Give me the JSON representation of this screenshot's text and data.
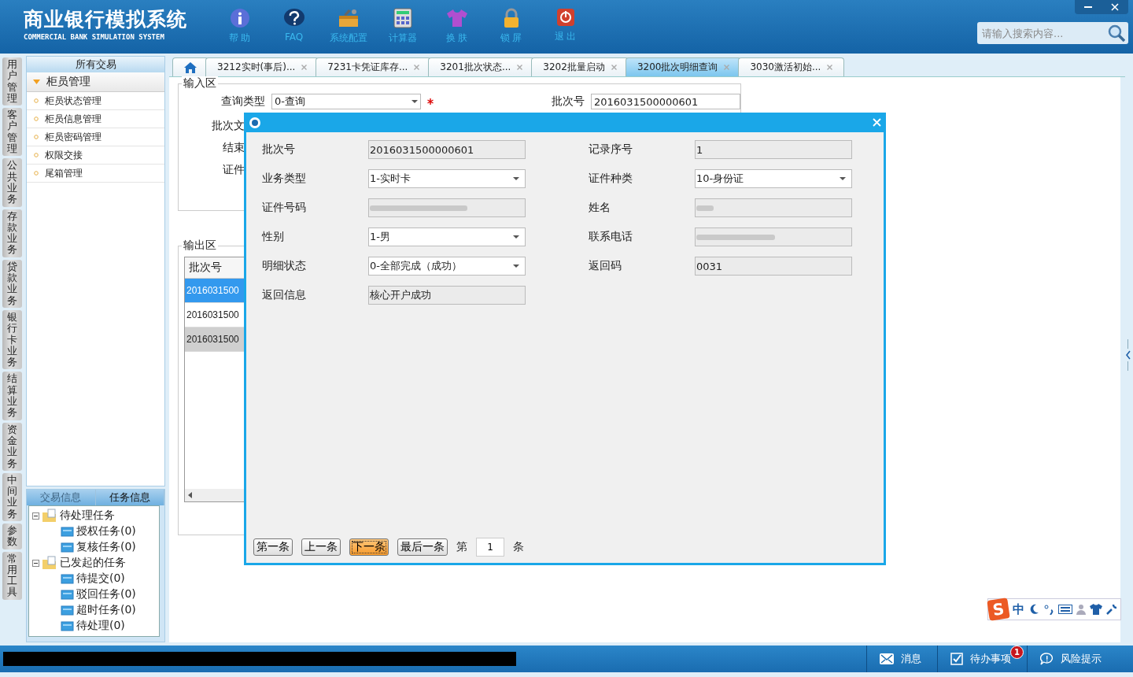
{
  "header": {
    "title": "商业银行模拟系统",
    "subtitle": "COMMERCIAL BANK SIMULATION SYSTEM",
    "toolbar": [
      {
        "kind": "info",
        "label": "帮 助"
      },
      {
        "kind": "faq",
        "label": "FAQ"
      },
      {
        "kind": "config",
        "label": "系统配置"
      },
      {
        "kind": "calc",
        "label": "计算器"
      },
      {
        "kind": "skin",
        "label": "换 肤"
      },
      {
        "kind": "lock",
        "label": "锁 屏"
      },
      {
        "kind": "exit",
        "label": "退 出"
      }
    ],
    "search": {
      "placeholder": "请输入搜索内容..."
    }
  },
  "side_tabs": [
    "用户管理",
    "客户管理",
    "公共业务",
    "存款业务",
    "贷款业务",
    "银行卡业务",
    "结算业务",
    "资金业务",
    "中间业务",
    "参数",
    "常用工具"
  ],
  "nav_panel": {
    "title": "所有交易",
    "group": {
      "label": "柜员管理",
      "expanded": true
    },
    "items": [
      "柜员状态管理",
      "柜员信息管理",
      "柜员密码管理",
      "权限交接",
      "尾箱管理"
    ]
  },
  "info_panel": {
    "tabs": [
      {
        "label": "交易信息",
        "selected": false
      },
      {
        "label": "任务信息",
        "selected": true
      }
    ],
    "tree": [
      {
        "label": "待处理任务",
        "expanded": true,
        "children": [
          {
            "label": "授权任务(0)"
          },
          {
            "label": "复核任务(0)"
          }
        ]
      },
      {
        "label": "已发起的任务",
        "expanded": true,
        "children": [
          {
            "label": "待提交(0)"
          },
          {
            "label": "驳回任务(0)"
          },
          {
            "label": "超时任务(0)"
          },
          {
            "label": "待处理(0)"
          }
        ]
      }
    ]
  },
  "tabs": [
    {
      "kind": "home",
      "selected": false
    },
    {
      "label": "3212实时(事后)...",
      "selected": false
    },
    {
      "label": "7231卡凭证库存...",
      "selected": false
    },
    {
      "label": "3201批次状态...",
      "selected": false
    },
    {
      "label": "3202批量启动",
      "selected": false
    },
    {
      "label": "3200批次明细查询",
      "selected": true
    },
    {
      "label": "3030激活初始...",
      "selected": false
    }
  ],
  "input_area": {
    "title": "输入区",
    "query_label": "查询类型",
    "query_value": "0-查询",
    "required": true,
    "labels": [
      "批次文",
      "结束",
      "证件"
    ],
    "batch_label": "批次号",
    "batch_value": "2016031500000601"
  },
  "output_area": {
    "title": "输出区",
    "column": "批次号",
    "rows": [
      {
        "value": "2016031500",
        "selected": true,
        "hover": false
      },
      {
        "value": "2016031500",
        "selected": false,
        "hover": false
      },
      {
        "value": "2016031500",
        "selected": false,
        "hover": true
      }
    ]
  },
  "dialog": {
    "fields": [
      {
        "label": "批次号",
        "kind": "text",
        "value": "2016031500000601",
        "blurred": false
      },
      {
        "label": "记录序号",
        "kind": "text",
        "value": "1",
        "blurred": false
      },
      {
        "label": "业务类型",
        "kind": "select",
        "value": "1-实时卡",
        "blurred": false
      },
      {
        "label": "证件种类",
        "kind": "select",
        "value": "10-身份证",
        "blurred": false
      },
      {
        "label": "证件号码",
        "kind": "text",
        "blurred": true
      },
      {
        "label": "姓名",
        "kind": "text",
        "blurred": true
      },
      {
        "label": "性别",
        "kind": "select",
        "value": "1-男",
        "blurred": false
      },
      {
        "label": "联系电话",
        "kind": "text",
        "blurred": true
      },
      {
        "label": "明细状态",
        "kind": "select",
        "value": "0-全部完成（成功）",
        "blurred": false
      },
      {
        "label": "返回码",
        "kind": "text",
        "value": "0031",
        "blurred": false
      },
      {
        "label": "返回信息",
        "kind": "text",
        "value": "核心开户成功",
        "blurred": false
      }
    ],
    "nav": [
      {
        "label": "第一条",
        "selected": false
      },
      {
        "label": "上一条",
        "selected": false
      },
      {
        "label": "下一条",
        "selected": true
      },
      {
        "label": "最后一条",
        "selected": false
      }
    ],
    "page_prefix": "第",
    "page": "1",
    "page_suffix": "条"
  },
  "ime": {
    "logo": "S",
    "mode": "中"
  },
  "status_bar": {
    "items": [
      {
        "kind": "mail",
        "label": "消息"
      },
      {
        "kind": "todo",
        "label": "待办事项",
        "badge": "1"
      },
      {
        "kind": "chat",
        "label": "风险提示"
      }
    ]
  }
}
